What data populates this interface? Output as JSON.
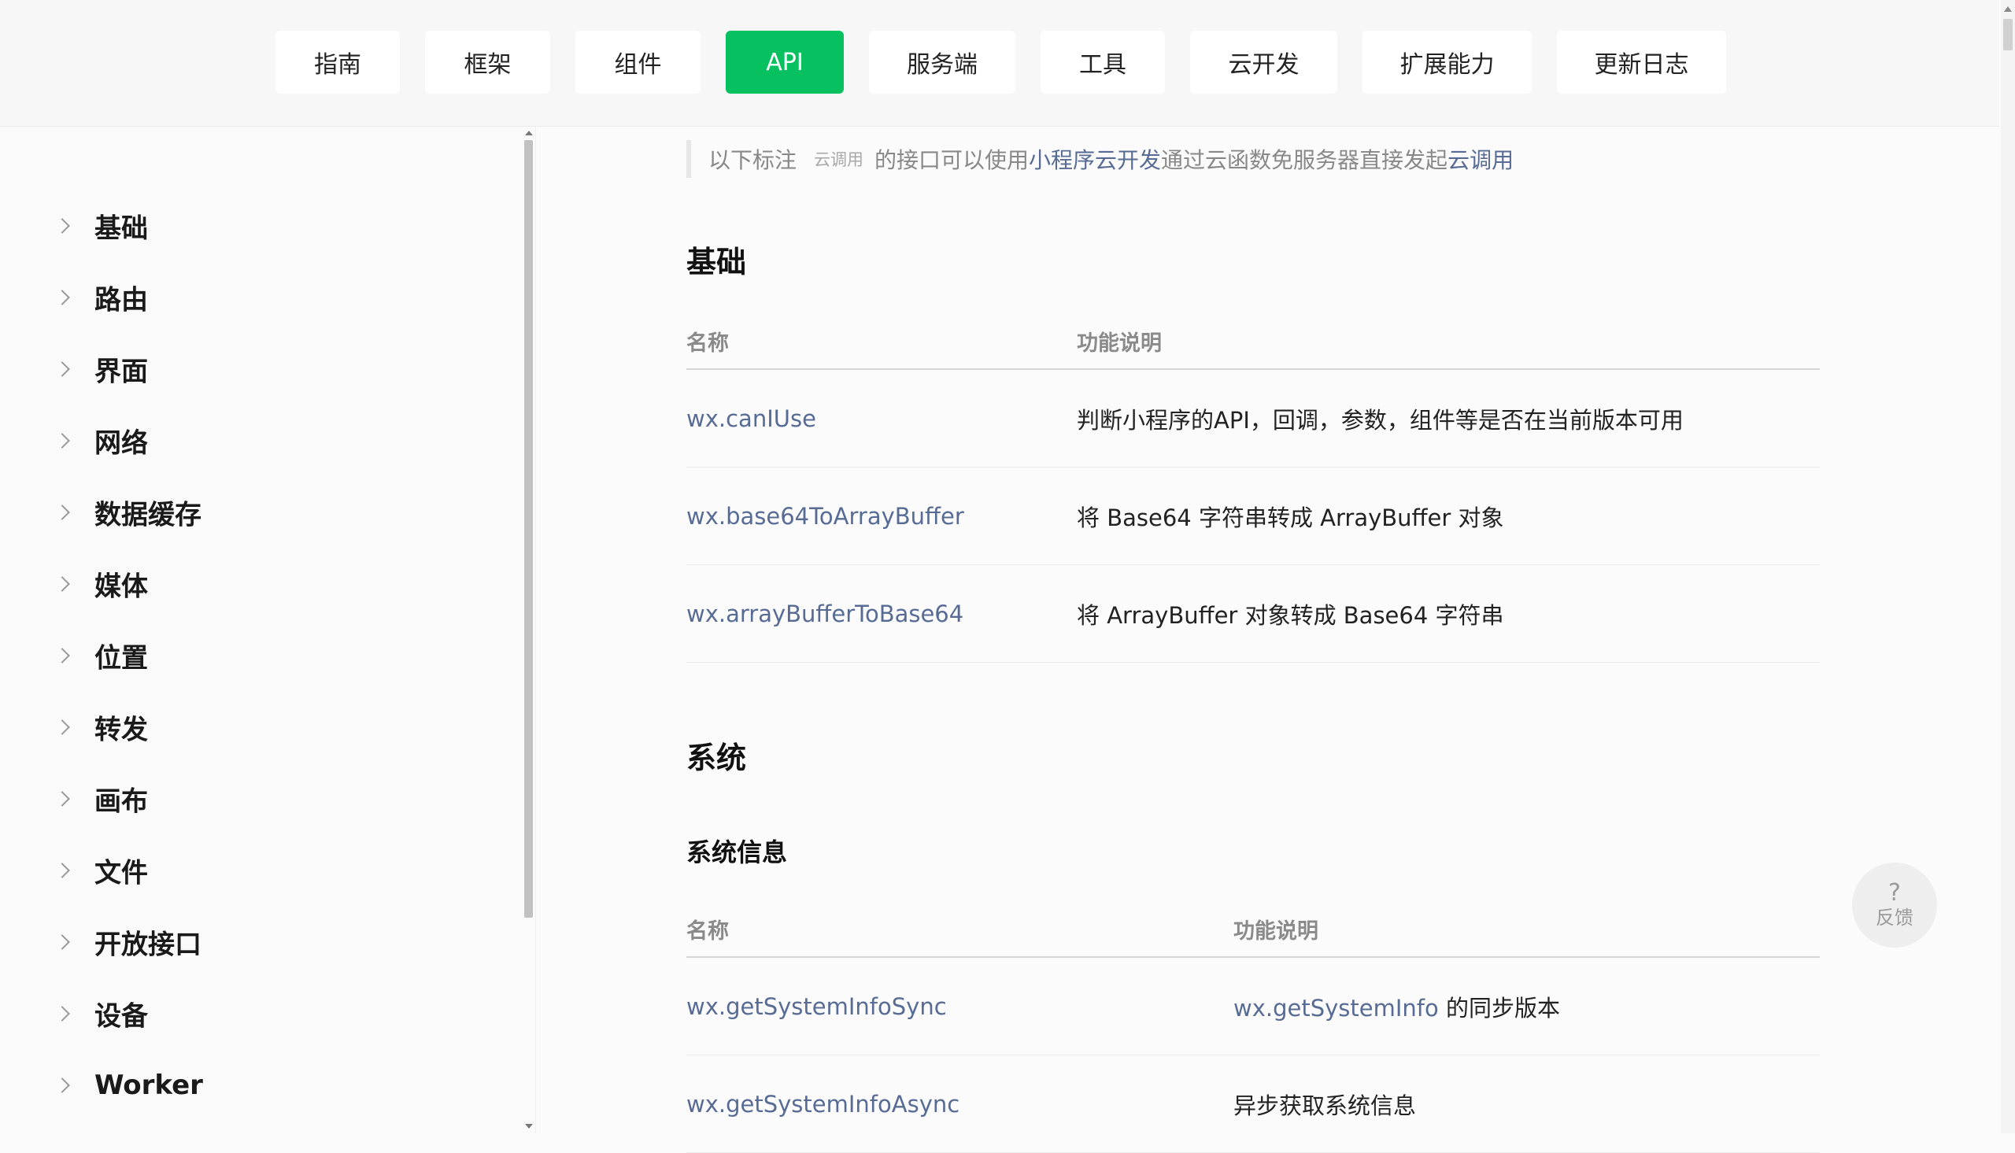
{
  "nav": {
    "tabs": [
      {
        "label": "指南"
      },
      {
        "label": "框架"
      },
      {
        "label": "组件"
      },
      {
        "label": "API",
        "active": true
      },
      {
        "label": "服务端"
      },
      {
        "label": "工具"
      },
      {
        "label": "云开发"
      },
      {
        "label": "扩展能力"
      },
      {
        "label": "更新日志"
      }
    ]
  },
  "sidebar": {
    "items": [
      {
        "label": "基础"
      },
      {
        "label": "路由"
      },
      {
        "label": "界面"
      },
      {
        "label": "网络"
      },
      {
        "label": "数据缓存"
      },
      {
        "label": "媒体"
      },
      {
        "label": "位置"
      },
      {
        "label": "转发"
      },
      {
        "label": "画布"
      },
      {
        "label": "文件"
      },
      {
        "label": "开放接口"
      },
      {
        "label": "设备"
      },
      {
        "label": "Worker"
      }
    ]
  },
  "notice": {
    "prefix": "以下标注",
    "tag": "云调用",
    "middle": "的接口可以使用",
    "link1": "小程序云开发",
    "middle2": "通过云函数免服务器直接发起",
    "link2": "云调用"
  },
  "sections": {
    "basic": {
      "title": "基础",
      "header": {
        "name": "名称",
        "desc": "功能说明"
      },
      "rows": [
        {
          "name": "wx.canIUse",
          "desc": "判断小程序的API，回调，参数，组件等是否在当前版本可用"
        },
        {
          "name": "wx.base64ToArrayBuffer",
          "desc": "将 Base64 字符串转成 ArrayBuffer 对象"
        },
        {
          "name": "wx.arrayBufferToBase64",
          "desc": "将 ArrayBuffer 对象转成 Base64 字符串"
        }
      ]
    },
    "system": {
      "title": "系统",
      "subtitle": "系统信息",
      "header": {
        "name": "名称",
        "desc": "功能说明"
      },
      "rows": [
        {
          "name": "wx.getSystemInfoSync",
          "desc_link": "wx.getSystemInfo",
          "desc": " 的同步版本"
        },
        {
          "name": "wx.getSystemInfoAsync",
          "desc": "异步获取系统信息"
        }
      ]
    }
  },
  "feedback": {
    "symbol": "?",
    "label": "反馈"
  }
}
